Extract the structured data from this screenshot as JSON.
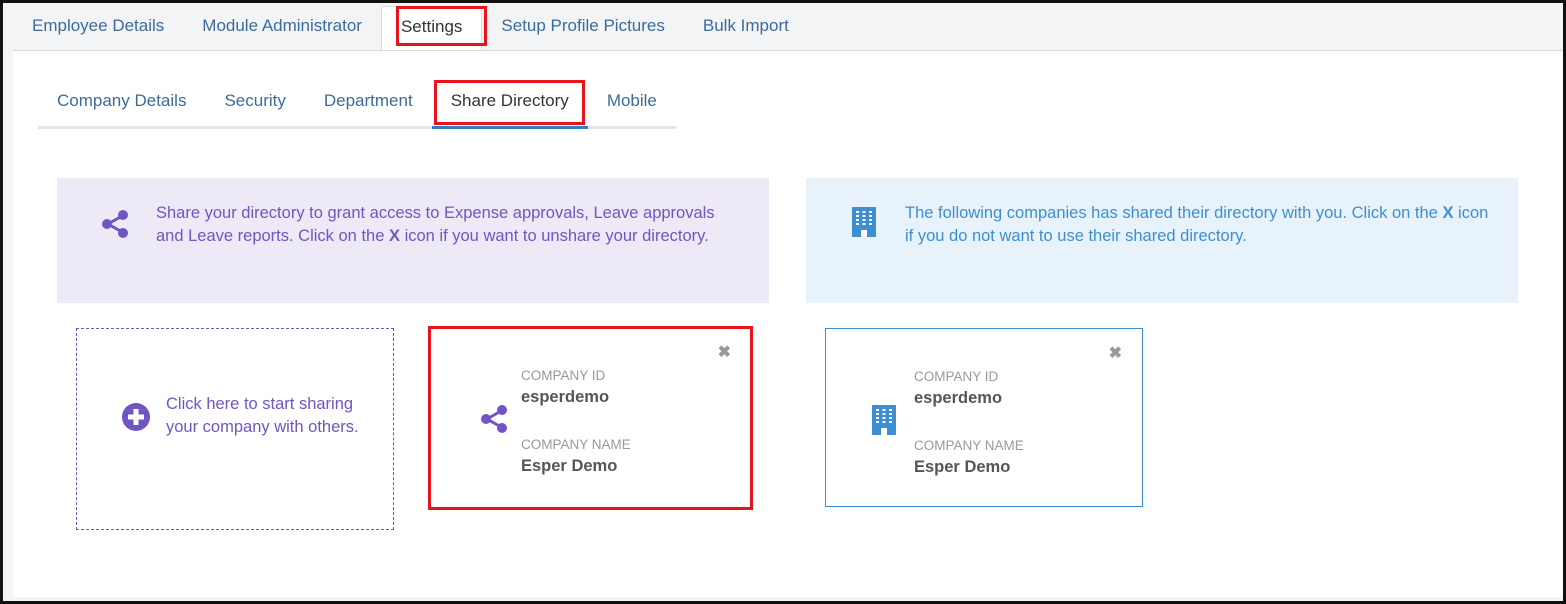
{
  "top_tabs": [
    {
      "label": "Employee Details"
    },
    {
      "label": "Module Administrator"
    },
    {
      "label": "Settings"
    },
    {
      "label": "Setup Profile Pictures"
    },
    {
      "label": "Bulk Import"
    }
  ],
  "sub_tabs": [
    {
      "label": "Company Details"
    },
    {
      "label": "Security"
    },
    {
      "label": "Department"
    },
    {
      "label": "Share Directory"
    },
    {
      "label": "Mobile"
    }
  ],
  "share_banner": {
    "text_before": "Share your directory to grant access to Expense approvals, Leave approvals and Leave reports. Click on the ",
    "x_label": "X",
    "text_after": " icon if you want to unshare your directory."
  },
  "shared_banner": {
    "text_before": "The following companies has shared their directory with you. Click on the ",
    "x_label": "X",
    "text_after": " icon if you do not want to use their shared directory."
  },
  "add_card": {
    "text": "Click here to start sharing your company with others."
  },
  "share_card": {
    "id_label": "COMPANY ID",
    "id_value": "esperdemo",
    "name_label": "COMPANY NAME",
    "name_value": "Esper Demo",
    "close_symbol": "✖"
  },
  "shared_card": {
    "id_label": "COMPANY ID",
    "id_value": "esperdemo",
    "name_label": "COMPANY NAME",
    "name_value": "Esper Demo",
    "close_symbol": "✖"
  },
  "colors": {
    "purple_accent": "#7155c4",
    "blue_accent": "#3d8fd2",
    "highlight": "#e8141b"
  },
  "icons": {
    "share": "share-icon",
    "building": "building-icon",
    "plus": "plus-circle-icon",
    "close": "close-icon"
  }
}
